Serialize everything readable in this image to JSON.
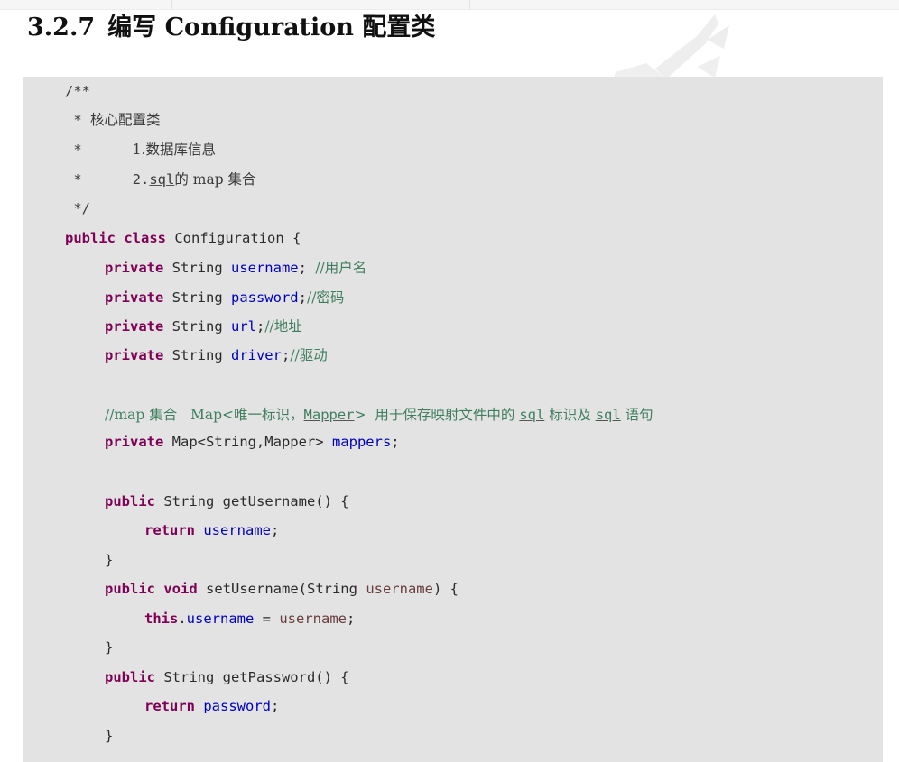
{
  "heading": {
    "number": "3.2.7",
    "title": "编写 Configuration 配置类"
  },
  "code": {
    "c_open": "/**",
    "c_star1": " * ",
    "c_core": "核心配置类",
    "c_star2": " *      ",
    "c_item1": "1.数据库信息",
    "c_star3": " *      ",
    "c_item2_pre": "2.",
    "c_item2_sql": "sql",
    "c_item2_post": "的 map 集合",
    "c_close": " */",
    "kw_public": "public",
    "kw_class": "class",
    "kw_private": "private",
    "kw_return": "return",
    "kw_void": "void",
    "kw_this": "this",
    "class_decl_rest": " Configuration {",
    "type_string": " String ",
    "f_username": "username",
    "f_password": "password",
    "f_url": "url",
    "f_driver": "driver",
    "semi_space": "; ",
    "semi": ";",
    "cmt_user": "//用户名",
    "cmt_pwd": "//密码",
    "cmt_url": "//地址",
    "cmt_driver": "//驱动",
    "cmt_map_a": "//map 集合   Map<唯一标识，",
    "cmt_map_mapper": "Mapper",
    "cmt_map_b": ">  用于保存映射文件中的 ",
    "cmt_map_sql1": "sql",
    "cmt_map_c": " 标识及 ",
    "cmt_map_sql2": "sql",
    "cmt_map_d": " 语句",
    "map_type": " Map<String,Mapper> ",
    "f_mappers": "mappers",
    "m_getUsername": " String getUsername() {",
    "m_setUsername_a": " setUsername(String ",
    "p_username": "username",
    "m_setUsername_b": ") {",
    "m_getPassword": " String getPassword() {",
    "dot": ".",
    "assign": " = ",
    "close_brace": "}"
  }
}
